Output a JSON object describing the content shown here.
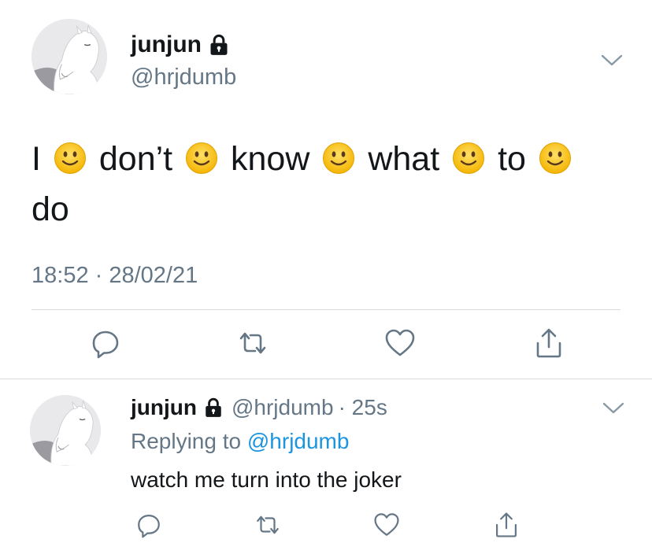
{
  "main_tweet": {
    "display_name": "junjun",
    "handle": "@hrjdumb",
    "text_words": [
      "I",
      "don’t",
      "know",
      "what",
      "to",
      "do"
    ],
    "emoji": "slightly-smiling-face",
    "timestamp": "18:52 · 28/02/21"
  },
  "reply_tweet": {
    "display_name": "junjun",
    "handle": "@hrjdumb",
    "time_ago": "· 25s",
    "replying_prefix": "Replying to",
    "replying_mention": "@hrjdumb",
    "text": "watch me turn into the joker"
  },
  "icons": {
    "lock": "lock-icon",
    "chevron": "chevron-down-icon",
    "reply": "reply-icon",
    "retweet": "retweet-icon",
    "like": "heart-icon",
    "share": "share-icon"
  },
  "colors": {
    "text": "#14171a",
    "secondary": "#657786",
    "link": "#1b95e0",
    "divider": "#d6dadd",
    "emoji": "#fbc02d"
  }
}
